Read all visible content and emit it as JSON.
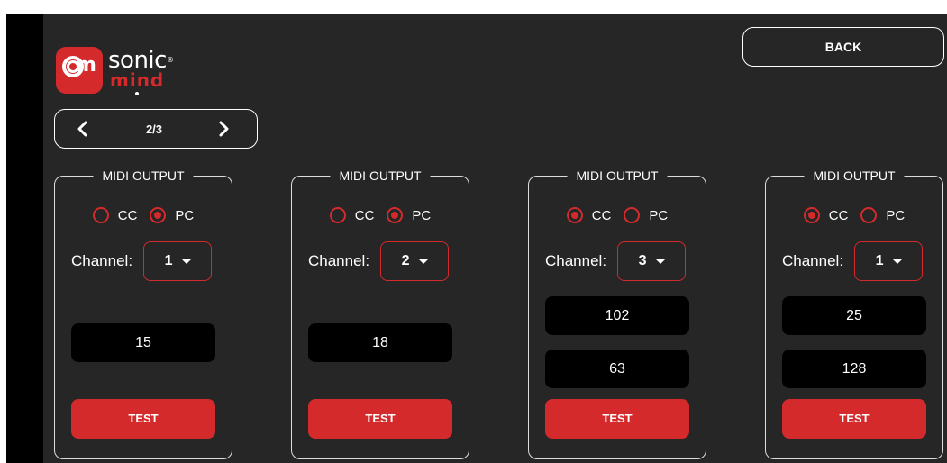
{
  "header": {
    "logo_word": "sonic",
    "logo_word2": "mind",
    "back_label": "BACK"
  },
  "pager": {
    "page": "2/3"
  },
  "colors": {
    "accent": "#d42a2c",
    "background": "#262626",
    "field": "#000000"
  },
  "cards": [
    {
      "title": "MIDI OUTPUT",
      "cc_label": "CC",
      "pc_label": "PC",
      "mode": "PC",
      "channel_label": "Channel:",
      "channel": "1",
      "values": [
        "15"
      ],
      "test_label": "TEST"
    },
    {
      "title": "MIDI OUTPUT",
      "cc_label": "CC",
      "pc_label": "PC",
      "mode": "PC",
      "channel_label": "Channel:",
      "channel": "2",
      "values": [
        "18"
      ],
      "test_label": "TEST"
    },
    {
      "title": "MIDI OUTPUT",
      "cc_label": "CC",
      "pc_label": "PC",
      "mode": "CC",
      "channel_label": "Channel:",
      "channel": "3",
      "values": [
        "102",
        "63"
      ],
      "test_label": "TEST"
    },
    {
      "title": "MIDI OUTPUT",
      "cc_label": "CC",
      "pc_label": "PC",
      "mode": "CC",
      "channel_label": "Channel:",
      "channel": "1",
      "values": [
        "25",
        "128"
      ],
      "test_label": "TEST"
    }
  ]
}
